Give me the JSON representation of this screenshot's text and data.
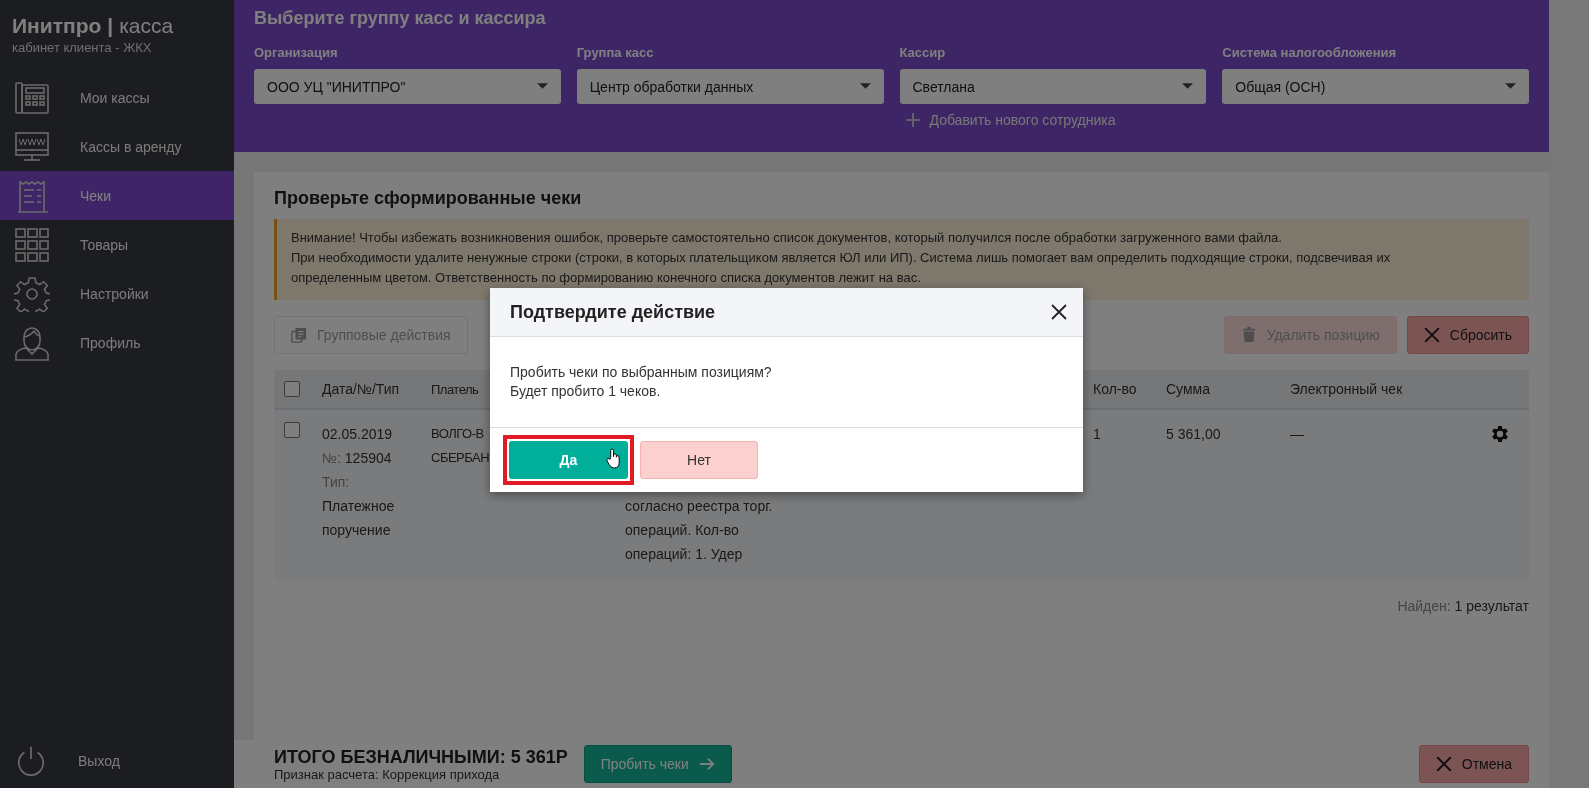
{
  "sidebar": {
    "brand_bold": "Инитпро",
    "brand_sep": "|",
    "brand_light": "касса",
    "subtitle": "кабинет клиента - ЖКХ",
    "items": [
      {
        "kind": "register",
        "label": "Мои кассы",
        "selected": false
      },
      {
        "kind": "monitor",
        "label": "Кассы в аренду",
        "selected": false
      },
      {
        "kind": "receipt",
        "label": "Чеки",
        "selected": true
      },
      {
        "kind": "grid",
        "label": "Товары",
        "selected": false
      },
      {
        "kind": "gear",
        "label": "Настройки",
        "selected": false
      },
      {
        "kind": "person",
        "label": "Профиль",
        "selected": false
      }
    ],
    "logout": "Выход"
  },
  "header": {
    "title": "Выберите группу касс и кассира",
    "fields": [
      {
        "label": "Организация",
        "value": "ООО УЦ \"ИНИТПРО\""
      },
      {
        "label": "Группа касс",
        "value": "Центр обработки данных"
      },
      {
        "label": "Кассир",
        "value": "Светлана"
      },
      {
        "label": "Система налогообложения",
        "value": "Общая (ОСН)"
      }
    ],
    "add_link": "Добавить нового сотрудника"
  },
  "card": {
    "title": "Проверьте сформированные чеки",
    "warning": [
      "Внимание! Чтобы избежать возникновения ошибок, проверьте самостоятельно список документов, который получился после обработки загруженного вами файла.",
      "При необходимости удалите ненужные строки (строки, в которых плательщиком является ЮЛ или ИП). Система лишь помогает вам определить подходящие строки, подсвечивая их определенным цветом. Ответственность по формированию конечного списка документов лежит на вас."
    ],
    "group_actions": {
      "label": "Групповые действия",
      "disabled": true
    },
    "delete": {
      "label": "Удалить позицию",
      "disabled": true
    },
    "reset": "Сбросить"
  },
  "table": {
    "all_checked": false,
    "columns": [
      {
        "label": "Дата/№/Тип"
      },
      {
        "label": "Платель"
      },
      {
        "label": "Кол-во"
      },
      {
        "label": "Сумма"
      },
      {
        "label": "Электронный чек"
      }
    ],
    "rows": [
      {
        "checked": false,
        "date": "02.05.2019",
        "number_label": "№:",
        "number": "125904",
        "type_label": "Тип:",
        "type": "Платежное поручение",
        "payer": [
          "ВОЛГО-В",
          "СБЕРБАН"
        ],
        "purpose": [
          "согласно реестра торг.",
          "операций. Кол-во",
          "операций: 1. Удер"
        ],
        "qty": "1",
        "sum": "5 361,00",
        "receipt": "—"
      }
    ],
    "found_label": "Найден:",
    "found_value": "1 результат"
  },
  "footer": {
    "total": "ИТОГО БЕЗНАЛИЧНЫМИ: 5 361Р",
    "sign": "Признак расчета: Коррекция прихода",
    "submit": "Пробить чеки",
    "cancel": "Отмена"
  },
  "modal": {
    "title": "Подтвердите действие",
    "lines": [
      "Пробить чеки по выбранным позициям?",
      "Будет пробито 1 чеков."
    ],
    "yes": "Да",
    "no": "Нет",
    "yes_highlighted": true
  }
}
